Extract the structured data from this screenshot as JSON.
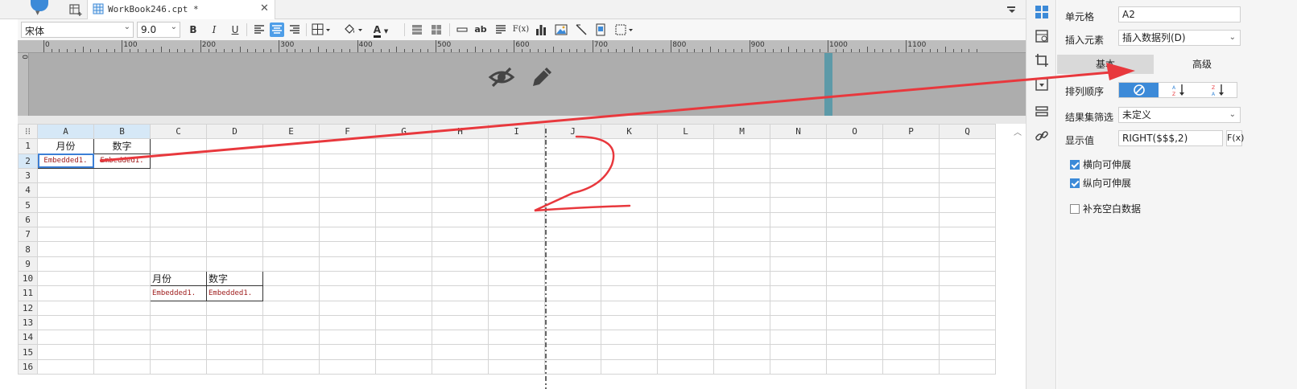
{
  "tabs": {
    "active_title": "WorkBook246.cpt *",
    "close_glyph": "✕"
  },
  "toolbar": {
    "font_name": "宋体",
    "font_size": "9.0",
    "bold": "B",
    "italic": "I",
    "underline": "U",
    "text_tool": "ab",
    "formula": "F(x)",
    "font_color_letter": "A"
  },
  "ruler": {
    "marks": [
      "0",
      "100",
      "200",
      "300",
      "400",
      "500",
      "600",
      "700",
      "800",
      "900",
      "1000",
      "1100"
    ],
    "vmark": "0"
  },
  "grid": {
    "columns": [
      "A",
      "B",
      "C",
      "D",
      "E",
      "F",
      "G",
      "H",
      "I",
      "J",
      "K",
      "L",
      "M",
      "N",
      "O",
      "P",
      "Q"
    ],
    "rows": [
      "1",
      "2",
      "3",
      "4",
      "5",
      "6",
      "7",
      "8",
      "9",
      "10",
      "11",
      "12",
      "13",
      "14",
      "15",
      "16"
    ],
    "a1": "月份",
    "b1": "数字",
    "a2": "Embedded1.",
    "b2": "Embedded1.",
    "c10": "月份",
    "d10": "数字",
    "c11": "Embedded1.",
    "d11": "Embedded1."
  },
  "props": {
    "cell_label": "单元格",
    "cell_value": "A2",
    "insert_label": "插入元素",
    "insert_value": "插入数据列(D)",
    "tab_basic": "基本",
    "tab_advanced": "高级",
    "sort_label": "排列顺序",
    "filter_label": "结果集筛选",
    "filter_value": "未定义",
    "display_label": "显示值",
    "display_value": "RIGHT($$$,2)",
    "fx": "F(x)",
    "check_horizontal": "横向可伸展",
    "check_vertical": "纵向可伸展",
    "check_fill": "补充空白数据"
  },
  "annotation": {
    "handwritten_text": "2",
    "arrow_color": "#e8383d"
  },
  "colors": {
    "accent": "#3c8ad8",
    "embedded_text": "#a02020",
    "header_area": "#adadad"
  }
}
